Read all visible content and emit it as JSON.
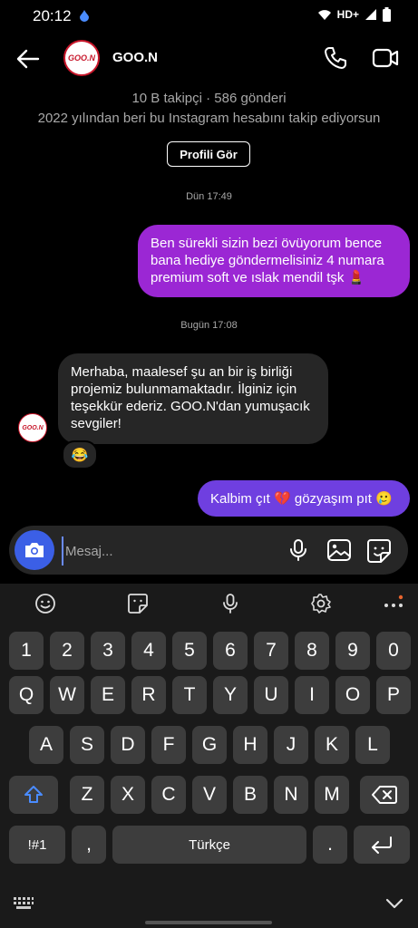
{
  "status_bar": {
    "time": "20:12",
    "network": "HD+"
  },
  "header": {
    "avatar_text": "GOO.N",
    "contact_name": "GOO.N"
  },
  "profile": {
    "stats": "10 B takipçi · 586 gönderi",
    "follow_info": "2022 yılından beri bu Instagram hesabını takip ediyorsun",
    "view_profile_button": "Profili Gör"
  },
  "conversation": {
    "timestamp_1": "Dün 17:49",
    "message_1": "Ben sürekli sizin bezi övüyorum bence bana hediye göndermelisiniz 4 numara premium soft  ve ıslak mendil tşk 💄",
    "timestamp_2": "Bugün 17:08",
    "message_2": "Merhaba, maalesef şu an bir iş birliği projemiz bulunmamaktadır. İlginiz için teşekkür ederiz. GOO.N'dan yumuşacık sevgiler!",
    "message_2_reaction": "😂",
    "message_3": "Kalbim çıt 💔 gözyaşım pıt 🥲"
  },
  "composer": {
    "placeholder": "Mesaj..."
  },
  "keyboard": {
    "row_numbers": [
      "1",
      "2",
      "3",
      "4",
      "5",
      "6",
      "7",
      "8",
      "9",
      "0"
    ],
    "row_1": [
      "Q",
      "W",
      "E",
      "R",
      "T",
      "Y",
      "U",
      "I",
      "O",
      "P"
    ],
    "row_2": [
      "A",
      "S",
      "D",
      "F",
      "G",
      "H",
      "J",
      "K",
      "L"
    ],
    "row_3": [
      "Z",
      "X",
      "C",
      "V",
      "B",
      "N",
      "M"
    ],
    "symbols_key": "!#1",
    "comma_key": ",",
    "space_key": "Türkçe",
    "period_key": "."
  },
  "colors": {
    "outgoing_bubble_1": "#9b27d4",
    "outgoing_bubble_2": "#6f3fe0",
    "incoming_bubble": "#262626",
    "camera_button": "#3b5fe6",
    "shift_active": "#4a8cff"
  }
}
